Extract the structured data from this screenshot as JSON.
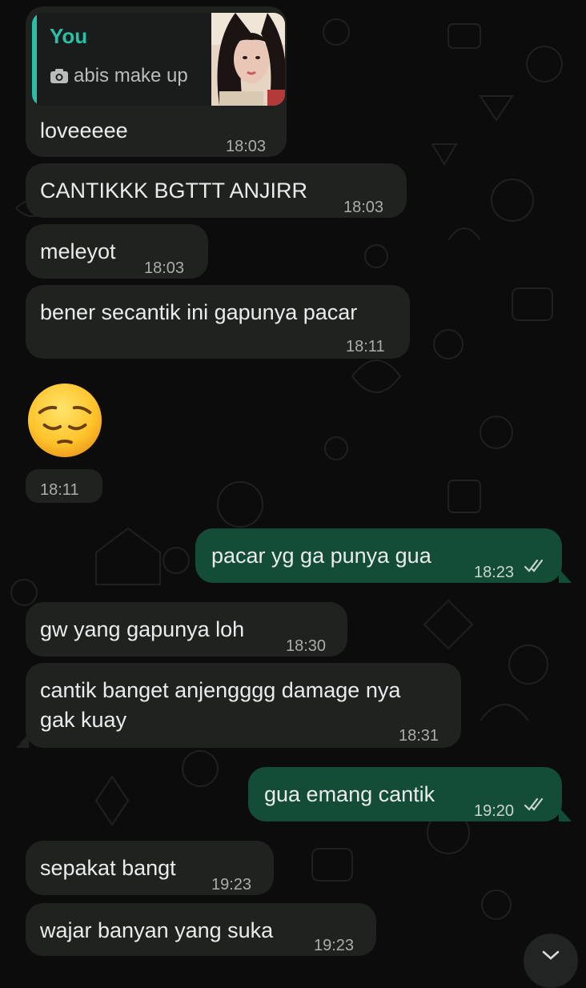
{
  "chat": {
    "quoted": {
      "author": "You",
      "caption": "abis make up",
      "media_icon": "camera-icon"
    },
    "messages": [
      {
        "text": "loveeeee",
        "time": "18:03",
        "direction": "incoming"
      },
      {
        "text": "CANTIKKK BGTTT ANJIRR",
        "time": "18:03",
        "direction": "incoming"
      },
      {
        "text": "meleyot",
        "time": "18:03",
        "direction": "incoming"
      },
      {
        "text": "bener secantik ini gapunya pacar",
        "time": "18:11",
        "direction": "incoming"
      },
      {
        "text": "😔",
        "time": "18:11",
        "direction": "incoming",
        "type": "emoji",
        "emoji_name": "pensive-face"
      },
      {
        "text": "pacar yg ga punya gua",
        "time": "18:23",
        "direction": "outgoing",
        "status": "read"
      },
      {
        "text": "gw yang gapunya loh",
        "time": "18:30",
        "direction": "incoming"
      },
      {
        "line1": "cantik banget anjengggg damage nya",
        "line2": "gak kuay",
        "time": "18:31",
        "direction": "incoming"
      },
      {
        "text": "gua emang cantik",
        "time": "19:20",
        "direction": "outgoing",
        "status": "read"
      },
      {
        "text": "sepakat bangt",
        "time": "19:23",
        "direction": "incoming"
      },
      {
        "text": "wajar banyan yang suka",
        "time": "19:23",
        "direction": "incoming"
      }
    ],
    "scroll_button_icon": "chevron-down-icon"
  },
  "colors": {
    "background": "#0b0c0b",
    "incoming_bubble": "#202220",
    "outgoing_bubble": "#144d37",
    "quote_accent": "#2bbfa6",
    "text": "#eaecec",
    "timestamp": "#a9aeab"
  }
}
